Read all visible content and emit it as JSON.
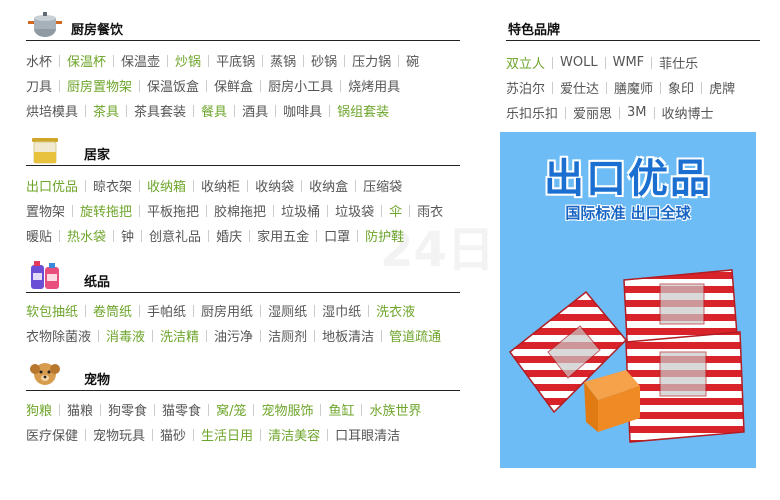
{
  "sections": [
    {
      "title": "厨房餐饮",
      "icon": "pot-icon",
      "rows": [
        [
          {
            "t": "水杯",
            "h": false
          },
          {
            "t": "保温杯",
            "h": true
          },
          {
            "t": "保温壶",
            "h": false
          },
          {
            "t": "炒锅",
            "h": true
          },
          {
            "t": "平底锅",
            "h": false
          },
          {
            "t": "蒸锅",
            "h": false
          },
          {
            "t": "砂锅",
            "h": false
          },
          {
            "t": "压力锅",
            "h": false
          },
          {
            "t": "碗",
            "h": false
          }
        ],
        [
          {
            "t": "刀具",
            "h": false
          },
          {
            "t": "厨房置物架",
            "h": true
          },
          {
            "t": "保温饭盒",
            "h": false
          },
          {
            "t": "保鲜盒",
            "h": false
          },
          {
            "t": "厨房小工具",
            "h": false
          },
          {
            "t": "烧烤用具",
            "h": false
          }
        ],
        [
          {
            "t": "烘培模具",
            "h": false
          },
          {
            "t": "茶具",
            "h": true
          },
          {
            "t": "茶具套装",
            "h": false
          },
          {
            "t": "餐具",
            "h": true
          },
          {
            "t": "酒具",
            "h": false
          },
          {
            "t": "咖啡具",
            "h": false
          },
          {
            "t": "锅组套装",
            "h": true
          }
        ]
      ]
    },
    {
      "title": "居家",
      "icon": "jar-icon",
      "rows": [
        [
          {
            "t": "出口优品",
            "h": true
          },
          {
            "t": "晾衣架",
            "h": false
          },
          {
            "t": "收纳箱",
            "h": true
          },
          {
            "t": "收纳柜",
            "h": false
          },
          {
            "t": "收纳袋",
            "h": false
          },
          {
            "t": "收纳盒",
            "h": false
          },
          {
            "t": "压缩袋",
            "h": false
          }
        ],
        [
          {
            "t": "置物架",
            "h": false
          },
          {
            "t": "旋转拖把",
            "h": true
          },
          {
            "t": "平板拖把",
            "h": false
          },
          {
            "t": "胶棉拖把",
            "h": false
          },
          {
            "t": "垃圾桶",
            "h": false
          },
          {
            "t": "垃圾袋",
            "h": false
          },
          {
            "t": "伞",
            "h": true
          },
          {
            "t": "雨衣",
            "h": false
          }
        ],
        [
          {
            "t": "暖贴",
            "h": false
          },
          {
            "t": "热水袋",
            "h": true
          },
          {
            "t": "钟",
            "h": false
          },
          {
            "t": "创意礼品",
            "h": false
          },
          {
            "t": "婚庆",
            "h": false
          },
          {
            "t": "家用五金",
            "h": false
          },
          {
            "t": "口罩",
            "h": false
          },
          {
            "t": "防护鞋",
            "h": true
          }
        ]
      ]
    },
    {
      "title": "纸品",
      "icon": "detergent-bottle-icon",
      "rows": [
        [
          {
            "t": "软包抽纸",
            "h": true
          },
          {
            "t": "卷筒纸",
            "h": true
          },
          {
            "t": "手帕纸",
            "h": false
          },
          {
            "t": "厨房用纸",
            "h": false
          },
          {
            "t": "湿厕纸",
            "h": false
          },
          {
            "t": "湿巾纸",
            "h": false
          },
          {
            "t": "洗衣液",
            "h": true
          }
        ],
        [
          {
            "t": "衣物除菌液",
            "h": false
          },
          {
            "t": "消毒液",
            "h": true
          },
          {
            "t": "洗洁精",
            "h": true
          },
          {
            "t": "油污净",
            "h": false
          },
          {
            "t": "洁厕剂",
            "h": false
          },
          {
            "t": "地板清洁",
            "h": false
          },
          {
            "t": "管道疏通",
            "h": true
          }
        ]
      ]
    },
    {
      "title": "宠物",
      "icon": "dog-icon",
      "rows": [
        [
          {
            "t": "狗粮",
            "h": true
          },
          {
            "t": "猫粮",
            "h": false
          },
          {
            "t": "狗零食",
            "h": false
          },
          {
            "t": "猫零食",
            "h": false
          },
          {
            "t": "窝/笼",
            "h": true
          },
          {
            "t": "宠物服饰",
            "h": true
          },
          {
            "t": "鱼缸",
            "h": true
          },
          {
            "t": "水族世界",
            "h": true
          }
        ],
        [
          {
            "t": "医疗保健",
            "h": false
          },
          {
            "t": "宠物玩具",
            "h": false
          },
          {
            "t": "猫砂",
            "h": false
          },
          {
            "t": "生活日用",
            "h": true
          },
          {
            "t": "清洁美容",
            "h": true
          },
          {
            "t": "口耳眼清洁",
            "h": false
          }
        ]
      ]
    }
  ],
  "brands": {
    "title": "特色品牌",
    "rows": [
      [
        {
          "t": "双立人",
          "h": true
        },
        {
          "t": "WOLL",
          "h": false
        },
        {
          "t": "WMF",
          "h": false
        },
        {
          "t": "菲仕乐",
          "h": false
        }
      ],
      [
        {
          "t": "苏泊尔",
          "h": false
        },
        {
          "t": "爱仕达",
          "h": false
        },
        {
          "t": "膳魔师",
          "h": false
        },
        {
          "t": "象印",
          "h": false
        },
        {
          "t": "虎牌",
          "h": false
        }
      ],
      [
        {
          "t": "乐扣乐扣",
          "h": false
        },
        {
          "t": "爱丽思",
          "h": false
        },
        {
          "t": "3M",
          "h": false
        },
        {
          "t": "收纳博士",
          "h": false
        }
      ]
    ]
  },
  "banner": {
    "title": "出口优品",
    "subtitle": "国际标准 出口全球",
    "background": "#6dbcf6",
    "box_stripe_color": "#d8232a",
    "box_base_color": "#ffffff",
    "lid_box_color": "#f08a24"
  },
  "colors": {
    "highlight": "#6ea52b",
    "normal": "#555555",
    "divider": "#222222"
  }
}
